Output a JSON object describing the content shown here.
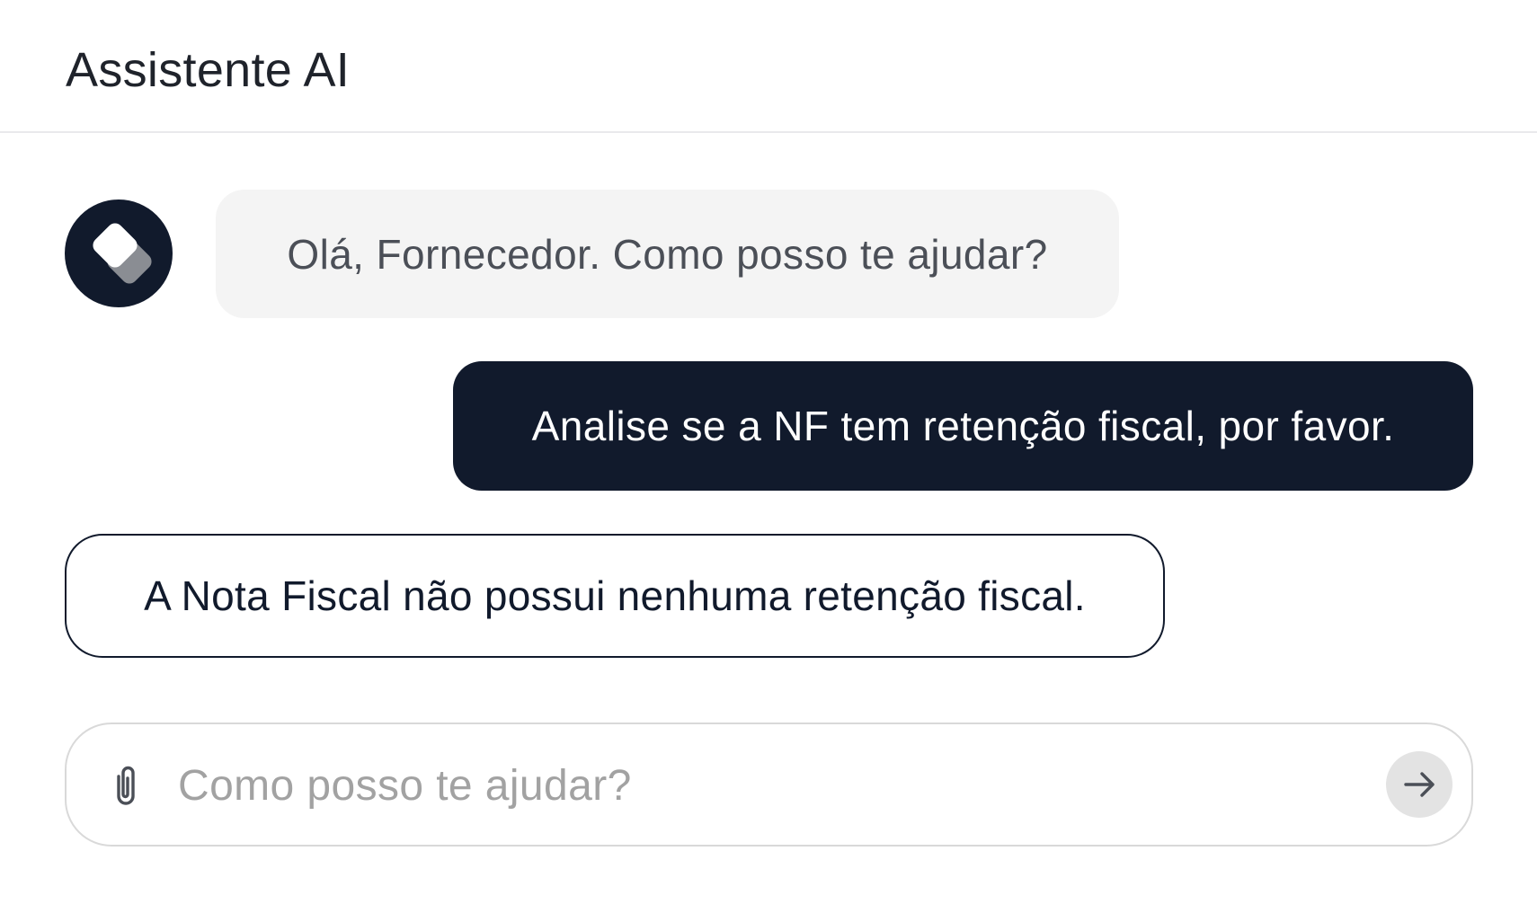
{
  "header": {
    "title": "Assistente AI"
  },
  "messages": [
    {
      "role": "assistant",
      "text": "Olá, Fornecedor. Como posso te ajudar?"
    },
    {
      "role": "user",
      "text": "Analise se a NF tem retenção fiscal, por favor."
    },
    {
      "role": "assistant",
      "text": "A Nota Fiscal não possui nenhuma retenção fiscal."
    }
  ],
  "composer": {
    "value": "",
    "placeholder": "Como posso te ajudar?",
    "attach_icon": "paperclip-icon",
    "send_icon": "arrow-right-icon"
  },
  "avatar": {
    "icon": "assistant-logo-icon"
  },
  "colors": {
    "primary_dark": "#111a2c",
    "assistant_bubble": "#f4f4f4",
    "send_button_bg": "#e3e3e3",
    "placeholder": "#a2a2a2"
  }
}
